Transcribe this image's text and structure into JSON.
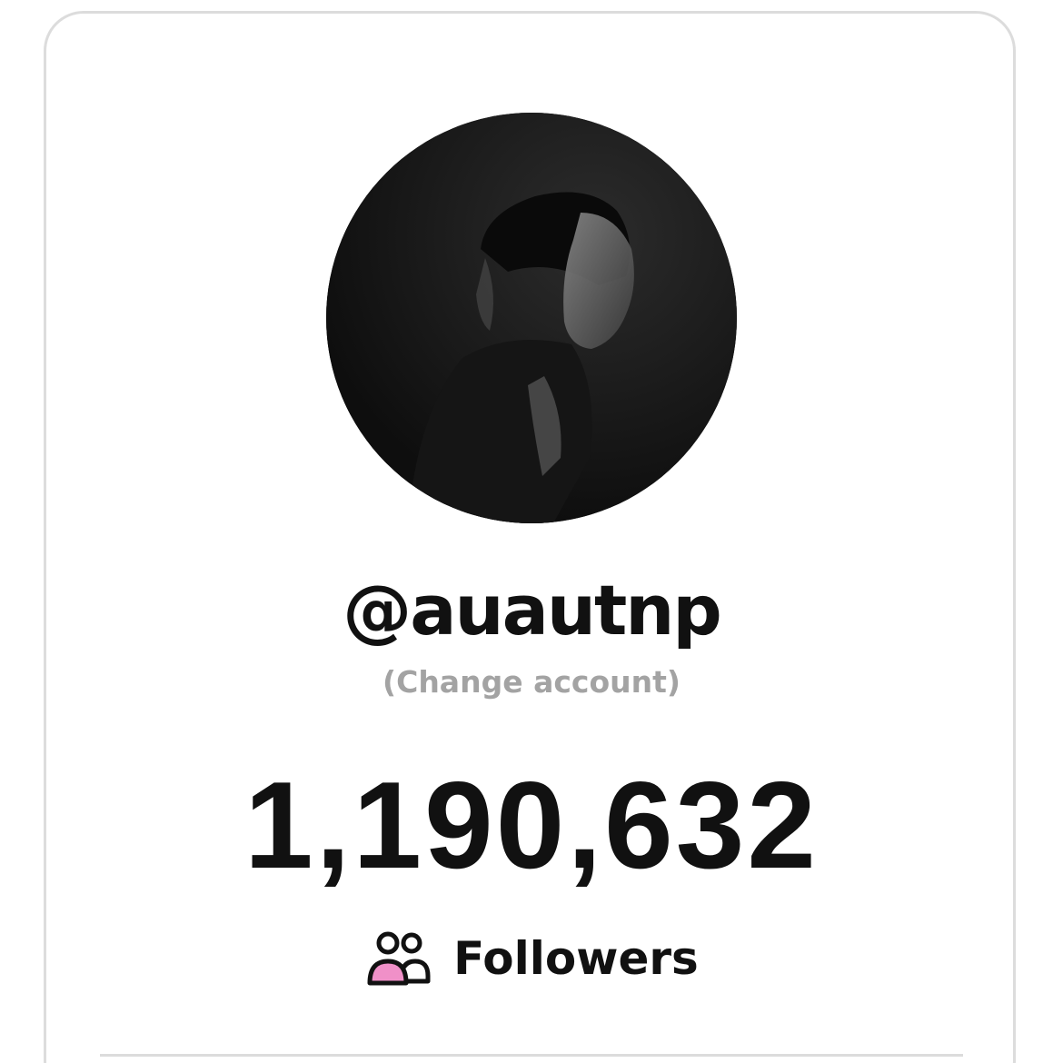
{
  "profile": {
    "username": "@auautnp",
    "change_account_label": "(Change account)"
  },
  "stats": {
    "count": "1,190,632",
    "label": "Followers",
    "icon": "followers-icon"
  },
  "colors": {
    "text": "#111111",
    "muted": "#a3a3a3",
    "accent": "#f090c8",
    "border": "#dcdcdc"
  }
}
